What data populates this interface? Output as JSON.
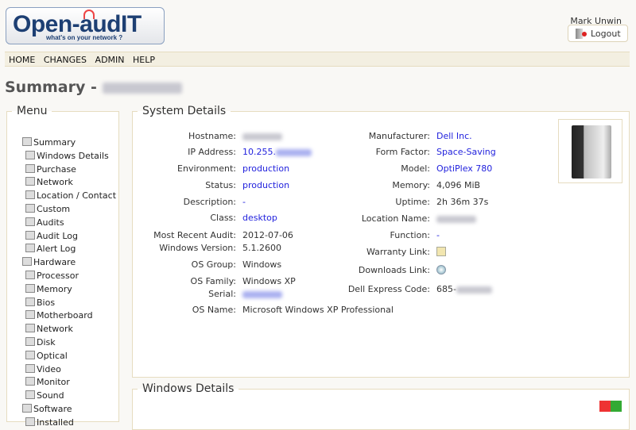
{
  "logo": {
    "text": "Open-audIT",
    "tagline": "what's on your network ?"
  },
  "user": {
    "name": "Mark Unwin",
    "logout_label": "Logout"
  },
  "nav": [
    "HOME",
    "CHANGES",
    "ADMIN",
    "HELP"
  ],
  "page_title": "Summary -",
  "menu": {
    "legend": "Menu",
    "items": [
      {
        "label": "Summary",
        "icon": "computer-icon",
        "sub": false
      },
      {
        "label": "Windows Details",
        "icon": "windows-icon",
        "sub": true
      },
      {
        "label": "Purchase",
        "icon": "document-icon",
        "sub": true
      },
      {
        "label": "Network",
        "icon": "network-icon",
        "sub": true
      },
      {
        "label": "Location / Contact",
        "icon": "house-icon",
        "sub": true
      },
      {
        "label": "Custom",
        "icon": "form-icon",
        "sub": true
      },
      {
        "label": "Audits",
        "icon": "magnifier-icon",
        "sub": true
      },
      {
        "label": "Audit Log",
        "icon": "edit-icon",
        "sub": true
      },
      {
        "label": "Alert Log",
        "icon": "warning-icon",
        "sub": true
      },
      {
        "label": "Hardware",
        "icon": "hardware-icon",
        "sub": false
      },
      {
        "label": "Processor",
        "icon": "processor-icon",
        "sub": true
      },
      {
        "label": "Memory",
        "icon": "memory-icon",
        "sub": true
      },
      {
        "label": "Bios",
        "icon": "bios-icon",
        "sub": true
      },
      {
        "label": "Motherboard",
        "icon": "motherboard-icon",
        "sub": true
      },
      {
        "label": "Network",
        "icon": "network-card-icon",
        "sub": true
      },
      {
        "label": "Disk",
        "icon": "disk-icon",
        "sub": true
      },
      {
        "label": "Optical",
        "icon": "optical-icon",
        "sub": true
      },
      {
        "label": "Video",
        "icon": "video-icon",
        "sub": true
      },
      {
        "label": "Monitor",
        "icon": "monitor-icon",
        "sub": true
      },
      {
        "label": "Sound",
        "icon": "sound-icon",
        "sub": true
      },
      {
        "label": "Software",
        "icon": "software-icon",
        "sub": false
      },
      {
        "label": "Installed",
        "icon": "installed-icon",
        "sub": true
      }
    ]
  },
  "system": {
    "legend": "System Details",
    "left": [
      {
        "label": "Hostname:",
        "value": "",
        "link": false,
        "blur": true
      },
      {
        "label": "IP Address:",
        "value": "10.255.",
        "link": true,
        "blur": true
      },
      {
        "label": "Environment:",
        "value": "production",
        "link": true
      },
      {
        "label": "Status:",
        "value": "production",
        "link": true
      },
      {
        "label": "Description:",
        "value": "-",
        "link": true
      },
      {
        "label": "Class:",
        "value": "desktop",
        "link": true
      },
      {
        "label": "Most Recent Audit:",
        "value": "2012-07-06",
        "link": false
      },
      {
        "label": "Windows Version:",
        "value": "5.1.2600",
        "link": false
      },
      {
        "label": "OS Group:",
        "value": "Windows",
        "link": false
      },
      {
        "label": "OS Family:",
        "value": "Windows XP",
        "link": false
      },
      {
        "label": "Serial:",
        "value": "",
        "link": true,
        "blur": true
      },
      {
        "label": "OS Name:",
        "value": "Microsoft Windows XP Professional",
        "link": false
      }
    ],
    "right": [
      {
        "label": "Manufacturer:",
        "value": "Dell Inc.",
        "link": true
      },
      {
        "label": "Form Factor:",
        "value": "Space-Saving",
        "link": true
      },
      {
        "label": "Model:",
        "value": "OptiPlex 780",
        "link": true
      },
      {
        "label": "Memory:",
        "value": "4,096 MiB",
        "link": false
      },
      {
        "label": "Uptime:",
        "value": "2h 36m 37s",
        "link": false
      },
      {
        "label": "Location Name:",
        "value": "",
        "link": false,
        "blur": true
      },
      {
        "label": "Function:",
        "value": "-",
        "link": true
      },
      {
        "label": "Warranty Link:",
        "value": "",
        "icon": "edit-icon"
      },
      {
        "label": "Downloads Link:",
        "value": "",
        "icon": "globe-icon"
      },
      {
        "label": "Dell Express Code:",
        "value": "685-",
        "link": false,
        "blur": true
      }
    ]
  },
  "windows": {
    "legend": "Windows Details"
  }
}
